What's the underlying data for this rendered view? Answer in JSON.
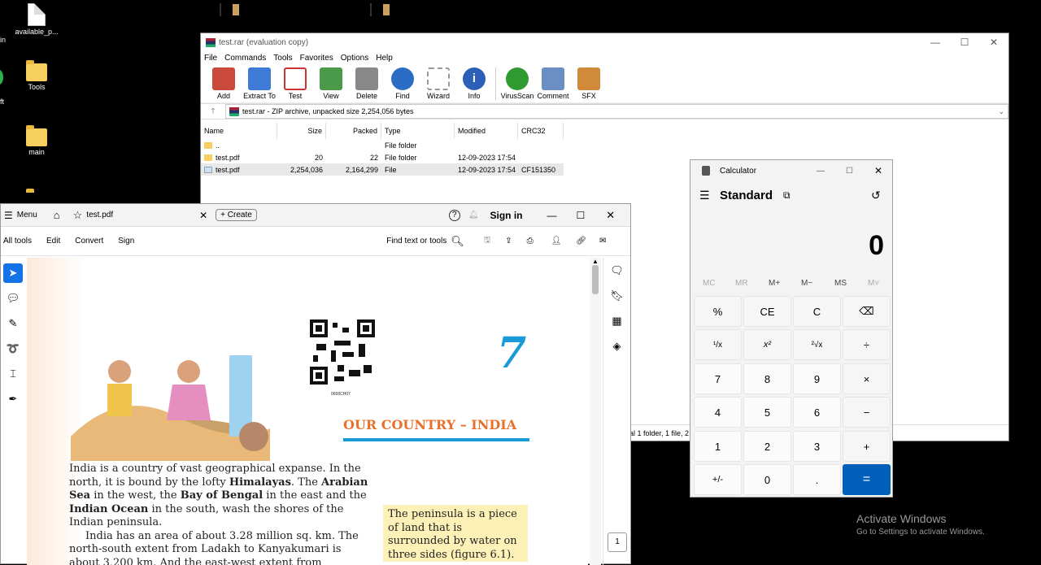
{
  "desktop": {
    "icons": [
      {
        "label": "available_p...",
        "kind": "file"
      },
      {
        "label": "Tools",
        "kind": "folder"
      },
      {
        "label": "main",
        "kind": "folder"
      }
    ],
    "partial_labels": [
      "in",
      "ft"
    ],
    "rar_icons": [
      "winrar-archive-icon",
      "winrar-archive-icon"
    ]
  },
  "winrar": {
    "title": "test.rar (evaluation copy)",
    "menu": [
      "File",
      "Commands",
      "Tools",
      "Favorites",
      "Options",
      "Help"
    ],
    "tools": [
      {
        "label": "Add",
        "color": "#c94a3a"
      },
      {
        "label": "Extract To",
        "color": "#3d7bd6"
      },
      {
        "label": "Test",
        "color": "#c33"
      },
      {
        "label": "View",
        "color": "#4a9a4a"
      },
      {
        "label": "Delete",
        "color": "#888"
      },
      {
        "label": "Find",
        "color": "#2b6cc4"
      },
      {
        "label": "Wizard",
        "color": "#999"
      },
      {
        "label": "Info",
        "color": "#2b5fb8"
      },
      {
        "label": "VirusScan",
        "color": "#2f9a2f"
      },
      {
        "label": "Comment",
        "color": "#6b8fc2"
      },
      {
        "label": "SFX",
        "color": "#d08a3a"
      }
    ],
    "path": "test.rar - ZIP archive, unpacked size 2,254,056 bytes",
    "columns": {
      "name": "Name",
      "size": "Size",
      "packed": "Packed",
      "type": "Type",
      "modified": "Modified",
      "crc": "CRC32"
    },
    "rows": [
      {
        "name": "..",
        "size": "",
        "packed": "",
        "type": "File folder",
        "modified": "",
        "crc": "",
        "kind": "fold"
      },
      {
        "name": "test.pdf",
        "size": "20",
        "packed": "22",
        "type": "File folder",
        "modified": "12-09-2023 17:54",
        "crc": "",
        "kind": "fold"
      },
      {
        "name": "test.pdf",
        "size": "2,254,036",
        "packed": "2,164,299",
        "type": "File",
        "modified": "12-09-2023 17:54",
        "crc": "CF151350",
        "kind": "file"
      }
    ],
    "status": "al 1 folder, 1 file, 2"
  },
  "acrobat": {
    "menu_label": "Menu",
    "tab_title": "test.pdf",
    "create_label": "Create",
    "signin_label": "Sign in",
    "toolbar": [
      "All tools",
      "Edit",
      "Convert",
      "Sign"
    ],
    "find_label": "Find text or tools",
    "page_number": "1",
    "book": {
      "chapter_number": "7",
      "qr_caption": "0656CH07",
      "chapter_title": "OUR COUNTRY – INDIA",
      "para1": [
        "India is a country of vast geographical expanse. In the",
        "north, it is bound by the lofty ",
        "Himalayas",
        ". The ",
        "Arabian",
        "Sea",
        " in the west, the ",
        "Bay of Bengal",
        " in the east and the",
        "Indian Ocean",
        " in the south, wash the shores of the",
        "Indian peninsula."
      ],
      "para2": [
        "India has an area of about 3.28 million sq. km. The",
        "north-south extent from Ladakh to Kanyakumari is",
        "about 3,200 km. And the east-west extent from"
      ],
      "box": [
        "The peninsula is a piece",
        "of land that is",
        "surrounded by water on",
        "three sides (figure 6.1)."
      ]
    }
  },
  "calculator": {
    "title": "Calculator",
    "mode": "Standard",
    "display": "0",
    "memory": [
      "MC",
      "MR",
      "M+",
      "M−",
      "MS",
      "M˅"
    ],
    "buttons": [
      [
        "%",
        "CE",
        "C",
        "⌫"
      ],
      [
        "¹/x",
        "x²",
        "²√x",
        "÷"
      ],
      [
        "7",
        "8",
        "9",
        "×"
      ],
      [
        "4",
        "5",
        "6",
        "−"
      ],
      [
        "1",
        "2",
        "3",
        "+"
      ],
      [
        "+/-",
        "0",
        ".",
        "="
      ]
    ],
    "accent": "#005fb8"
  },
  "activation": {
    "title": "Activate Windows",
    "subtitle": "Go to Settings to activate Windows."
  }
}
